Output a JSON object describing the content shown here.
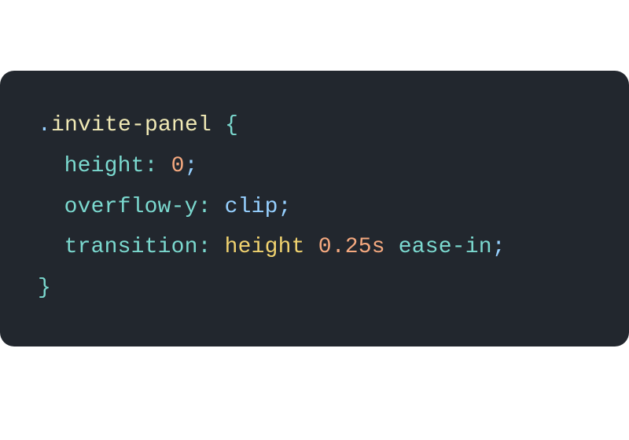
{
  "code": {
    "selector_dot": ".",
    "selector_name": "invite-panel",
    "space": " ",
    "brace_open": "{",
    "brace_close": "}",
    "decl1": {
      "prop": "height",
      "colon": ":",
      "value_num": "0",
      "semi": ";"
    },
    "decl2": {
      "prop": "overflow-y",
      "colon": ":",
      "value": "clip",
      "semi": ";"
    },
    "decl3": {
      "prop": "transition",
      "colon": ":",
      "v1": "height",
      "v2": "0.25s",
      "v3": "ease-in",
      "semi": ";"
    }
  }
}
